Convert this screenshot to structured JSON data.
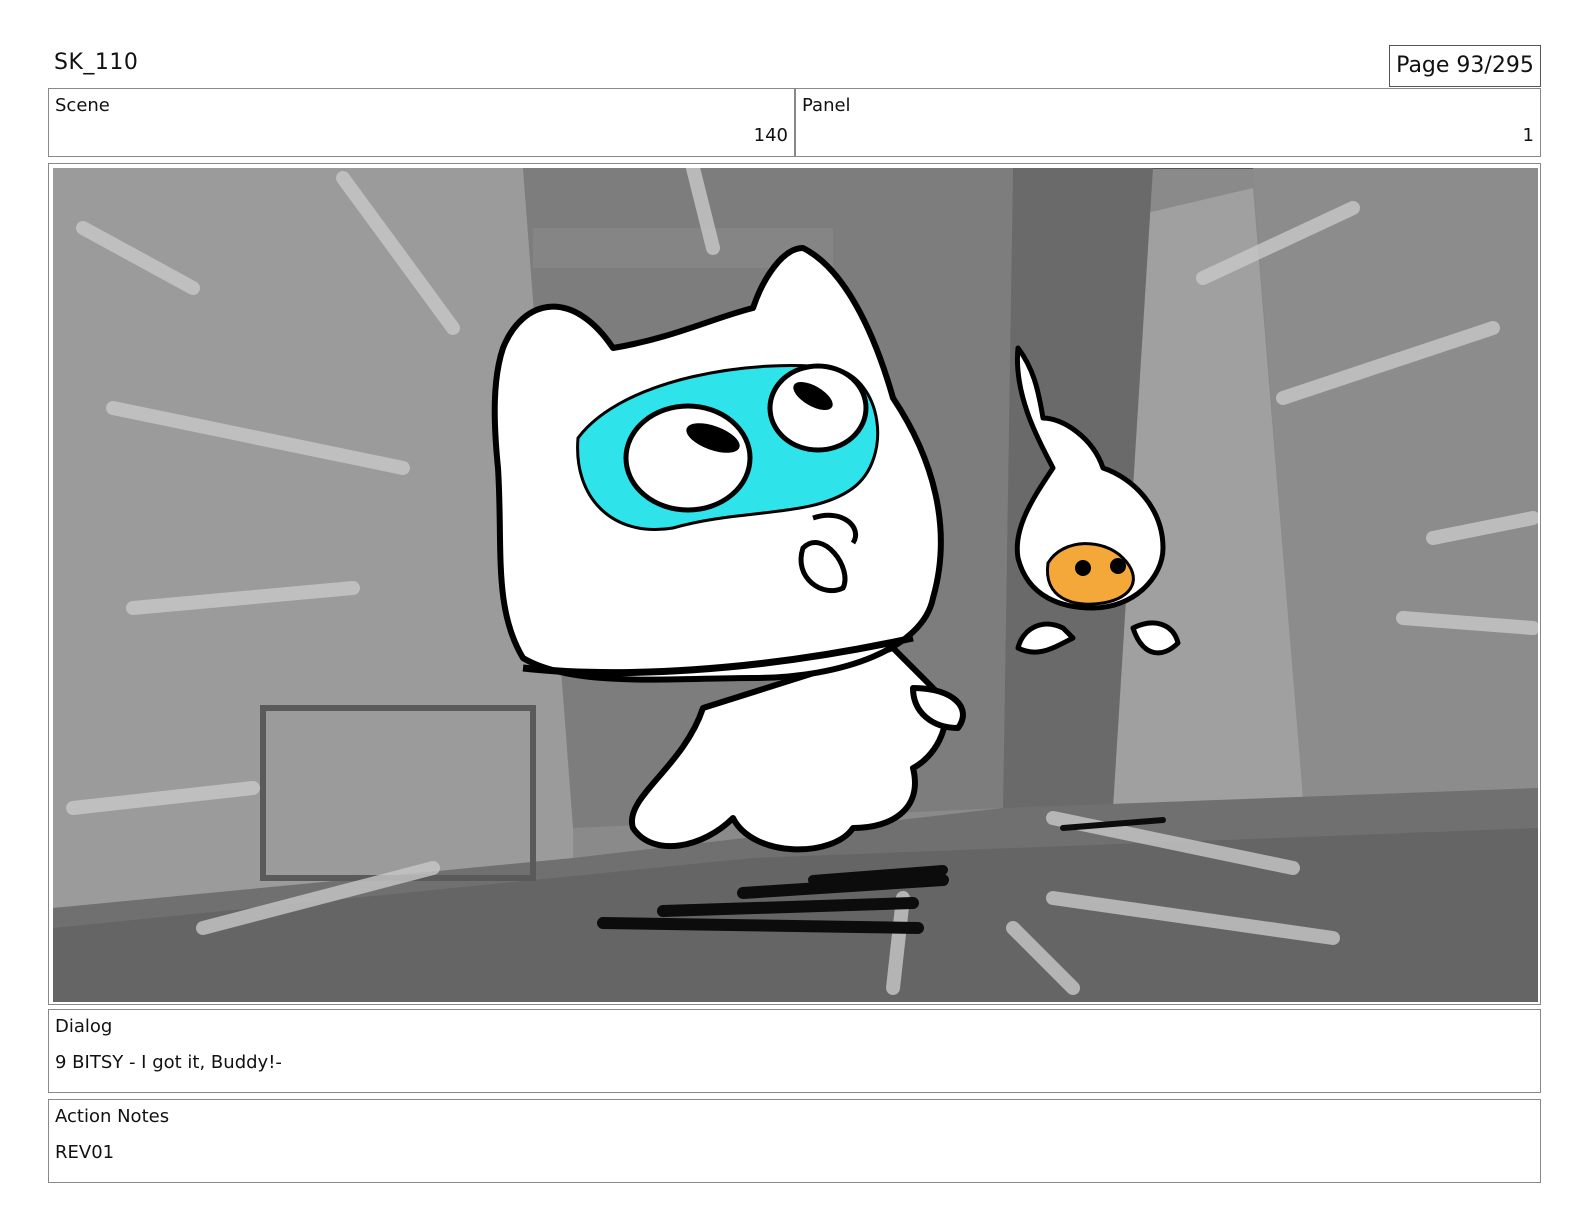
{
  "header": {
    "title": "SK_110",
    "page": "Page  93/295"
  },
  "scene": {
    "label": "Scene",
    "value": "140"
  },
  "panel": {
    "label": "Panel",
    "value": "1"
  },
  "dialog": {
    "label": "Dialog",
    "text": "9 BITSY - I got it, Buddy!-"
  },
  "notes": {
    "label": "Action Notes",
    "text": "REV01"
  },
  "colors": {
    "mask": "#2fe3ea",
    "orange": "#f5a83a",
    "bg_dark": "#6f6f6f",
    "bg_light": "#a9a9a9"
  }
}
